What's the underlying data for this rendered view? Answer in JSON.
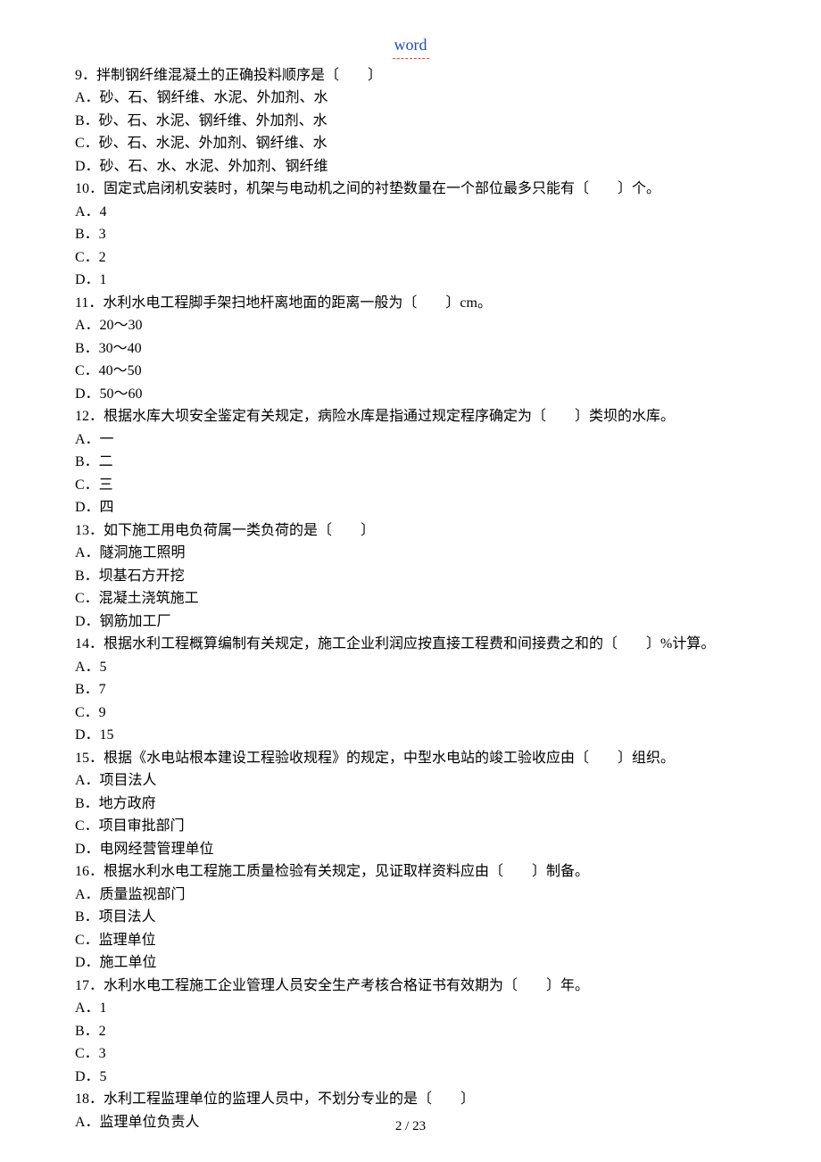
{
  "header": {
    "title": "word"
  },
  "questions": [
    {
      "stem": "9．拌制钢纤维混凝土的正确投料顺序是〔　　〕",
      "opts": [
        "A．砂、石、钢纤维、水泥、外加剂、水",
        "B．砂、石、水泥、钢纤维、外加剂、水",
        "C．砂、石、水泥、外加剂、钢纤维、水",
        "D．砂、石、水、水泥、外加剂、钢纤维"
      ]
    },
    {
      "stem": "10．固定式启闭机安装时，机架与电动机之间的衬垫数量在一个部位最多只能有〔　　〕个。",
      "opts": [
        "A．4",
        "B．3",
        "C．2",
        "D．1"
      ]
    },
    {
      "stem": "11．水利水电工程脚手架扫地杆离地面的距离一般为〔　　〕cm。",
      "opts": [
        "A．20～30",
        "B．30～40",
        "C．40～50",
        "D．50～60"
      ]
    },
    {
      "stem": "12．根据水库大坝安全鉴定有关规定，病险水库是指通过规定程序确定为〔　　〕类坝的水库。",
      "opts": [
        "A．一",
        "B．二",
        "C．三",
        "D．四"
      ]
    },
    {
      "stem": "13．如下施工用电负荷属一类负荷的是〔　　〕",
      "opts": [
        "A．隧洞施工照明",
        "B．坝基石方开挖",
        "C．混凝土浇筑施工",
        "D．钢筋加工厂"
      ]
    },
    {
      "stem": "14．根据水利工程概算编制有关规定，施工企业利润应按直接工程费和间接费之和的〔　　〕%计算。",
      "opts": [
        "A．5",
        "B．7",
        "C．9",
        "D．15"
      ]
    },
    {
      "stem": "15．根据《水电站根本建设工程验收规程》的规定，中型水电站的竣工验收应由〔　　〕组织。",
      "opts": [
        "A．项目法人",
        "B．地方政府",
        "C．项目审批部门",
        "D．电网经营管理单位"
      ]
    },
    {
      "stem": "16．根据水利水电工程施工质量检验有关规定，见证取样资料应由〔　　〕制备。",
      "opts": [
        "A．质量监视部门",
        "B．项目法人",
        "C．监理单位",
        "D．施工单位"
      ]
    },
    {
      "stem": "17．水利水电工程施工企业管理人员安全生产考核合格证书有效期为〔　　〕年。",
      "opts": [
        "A．1",
        "B．2",
        "C．3",
        "D．5"
      ]
    },
    {
      "stem": "18．水利工程监理单位的监理人员中，不划分专业的是〔　　〕",
      "opts": [
        "A．监理单位负责人"
      ]
    }
  ],
  "footer": {
    "page": "2 / 23"
  }
}
